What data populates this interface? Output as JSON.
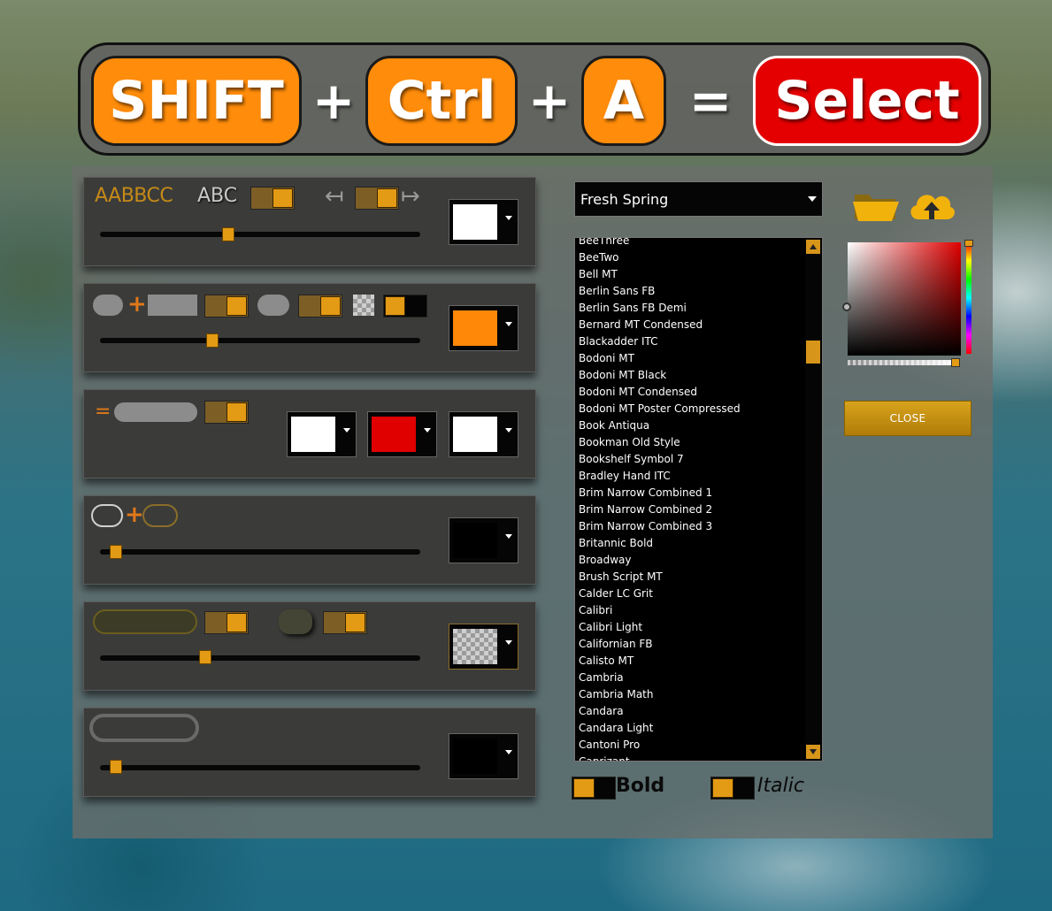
{
  "banner": {
    "key1": "SHIFT",
    "plus": "+",
    "key2": "Ctrl",
    "key3": "A",
    "equals": "=",
    "result": "Select"
  },
  "text_card": {
    "case_label": "AABBCC",
    "abc_label": "ABC",
    "slider_level": 0.4,
    "color": "#ffffff"
  },
  "shape_card": {
    "slider_level": 0.35,
    "color": "#ff8808"
  },
  "outline_card": {
    "colors": [
      "#ffffff",
      "#e00000",
      "#ffffff"
    ],
    "equals": "="
  },
  "border_card": {
    "slider_level": 0.05,
    "color": "#000000"
  },
  "shadow_card": {
    "slider_level": 0.33,
    "color": "transparent"
  },
  "frame_card": {
    "slider_level": 0.05,
    "color": "#000000"
  },
  "preset": {
    "selected": "Fresh Spring"
  },
  "fonts": [
    "BeeThree",
    "BeeTwo",
    "Bell MT",
    "Berlin Sans FB",
    "Berlin Sans FB Demi",
    "Bernard MT Condensed",
    "Blackadder ITC",
    "Bodoni MT",
    "Bodoni MT Black",
    "Bodoni MT Condensed",
    "Bodoni MT Poster Compressed",
    "Book Antiqua",
    "Bookman Old Style",
    "Bookshelf Symbol 7",
    "Bradley Hand ITC",
    "Brim Narrow Combined 1",
    "Brim Narrow Combined 2",
    "Brim Narrow Combined 3",
    "Britannic Bold",
    "Broadway",
    "Brush Script MT",
    "Calder LC Grit",
    "Calibri",
    "Calibri Light",
    "Californian FB",
    "Calisto MT",
    "Cambria",
    "Cambria Math",
    "Candara",
    "Candara Light",
    "Cantoni Pro",
    "Caprizant"
  ],
  "style": {
    "bold_label": "Bold",
    "italic_label": "Italic"
  },
  "color_panel": {
    "close_label": "CLOSE",
    "accent": "#e39a14"
  }
}
